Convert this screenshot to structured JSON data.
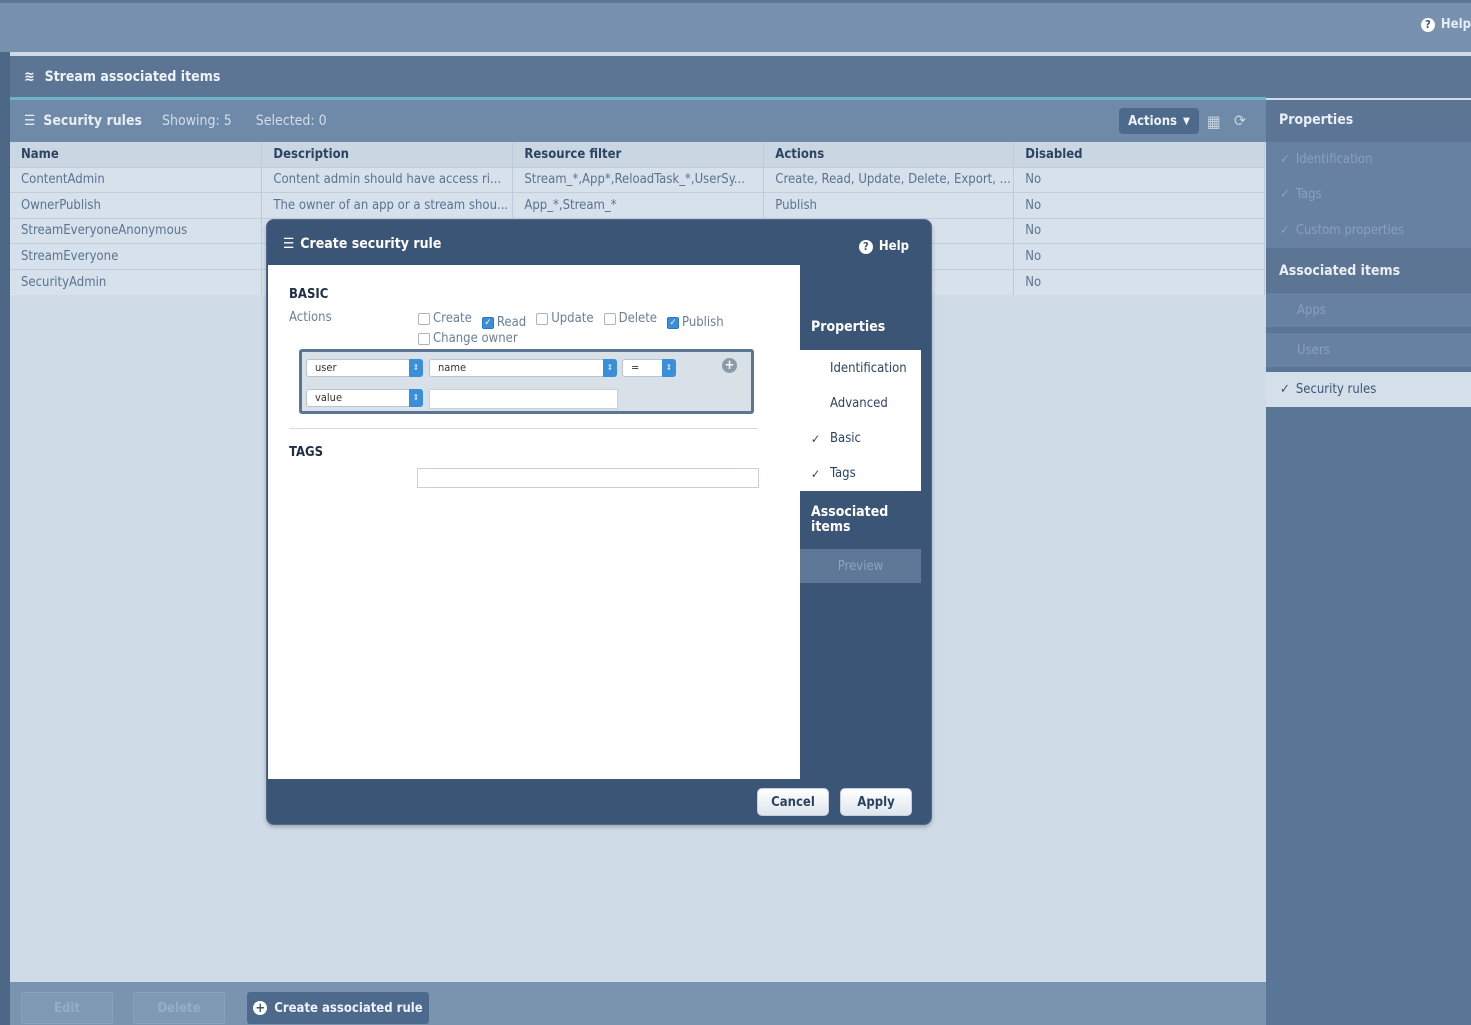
{
  "topbar": {
    "help": "Help"
  },
  "stream_header": {
    "title": "Stream associated items"
  },
  "toolbar": {
    "title": "Security rules",
    "showing": "Showing: 5",
    "selected": "Selected: 0",
    "actions": "Actions"
  },
  "table": {
    "columns": [
      "Name",
      "Description",
      "Resource filter",
      "Actions",
      "Disabled"
    ],
    "rows": [
      [
        "ContentAdmin",
        "Content admin should have access ri...",
        "Stream_*,App*,ReloadTask_*,UserSy...",
        "Create, Read, Update, Delete, Export, ...",
        "No"
      ],
      [
        "OwnerPublish",
        "The owner of an app or a stream shou...",
        "App_*,Stream_*",
        "Publish",
        "No"
      ],
      [
        "StreamEveryoneAnonymous",
        "",
        "",
        "",
        "No"
      ],
      [
        "StreamEveryone",
        "",
        "",
        "",
        "No"
      ],
      [
        "SecurityAdmin",
        "",
        "",
        "e, Export, ...",
        "No"
      ]
    ]
  },
  "right_panel": {
    "properties": "Properties",
    "prop_items": [
      "Identification",
      "Tags",
      "Custom properties"
    ],
    "associated": "Associated items",
    "assoc_items": [
      "Apps",
      "Users",
      "Security rules"
    ]
  },
  "bottom": {
    "edit": "Edit",
    "delete": "Delete",
    "create": "Create associated rule"
  },
  "dialog": {
    "title": "Create security rule",
    "help": "Help",
    "basic": "BASIC",
    "actions_label": "Actions",
    "checkboxes": [
      {
        "label": "Create",
        "checked": false
      },
      {
        "label": "Read",
        "checked": true
      },
      {
        "label": "Update",
        "checked": false
      },
      {
        "label": "Delete",
        "checked": false
      },
      {
        "label": "Publish",
        "checked": true
      },
      {
        "label": "Change owner",
        "checked": false
      }
    ],
    "condition": {
      "resource": "user",
      "property": "name",
      "operator": "=",
      "value_type": "value",
      "value": ""
    },
    "tags": "TAGS",
    "tags_value": "",
    "nav": {
      "properties": "Properties",
      "items": [
        {
          "label": "Identification",
          "checked": false
        },
        {
          "label": "Advanced",
          "checked": false
        },
        {
          "label": "Basic",
          "checked": true
        },
        {
          "label": "Tags",
          "checked": true
        }
      ],
      "associated": "Associated items",
      "preview": "Preview"
    },
    "cancel": "Cancel",
    "apply": "Apply"
  },
  "colors": {
    "accent": "#6fb3c9",
    "dialog": "#3b5577",
    "checkbox": "#3b8fd9"
  }
}
